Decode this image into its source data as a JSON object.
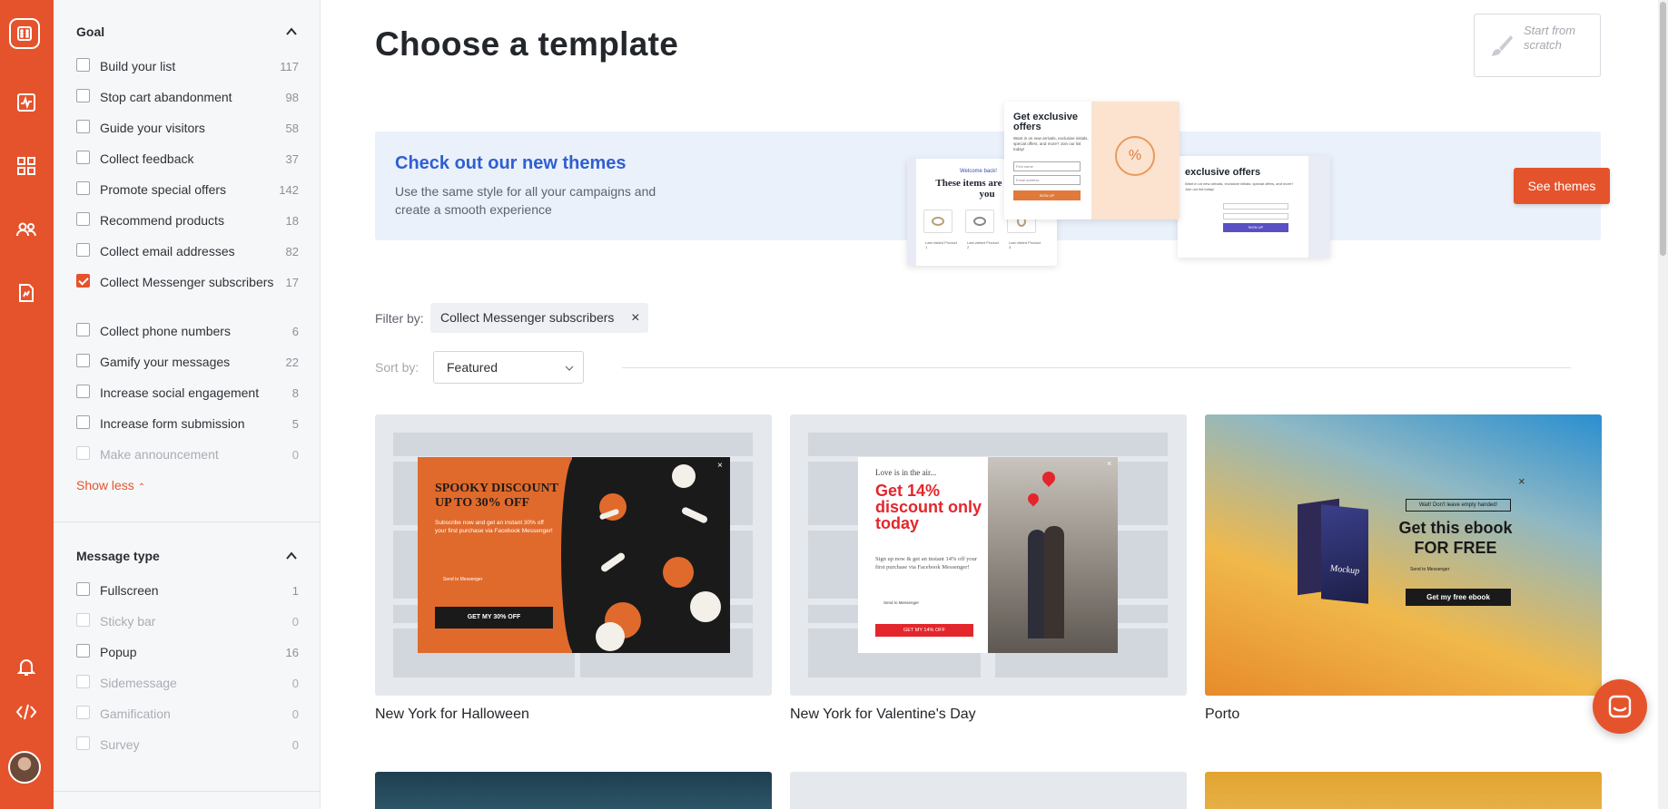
{
  "rail": {
    "icons": [
      "logo-icon",
      "analytics-icon",
      "campaigns-icon",
      "users-icon",
      "report-icon",
      "bell-icon",
      "code-icon",
      "avatar"
    ]
  },
  "sidebar": {
    "goal": {
      "heading": "Goal",
      "items": [
        {
          "label": "Build your list",
          "count": "117",
          "checked": false,
          "disabled": false
        },
        {
          "label": "Stop cart abandonment",
          "count": "98",
          "checked": false,
          "disabled": false
        },
        {
          "label": "Guide your visitors",
          "count": "58",
          "checked": false,
          "disabled": false
        },
        {
          "label": "Collect feedback",
          "count": "37",
          "checked": false,
          "disabled": false
        },
        {
          "label": "Promote special offers",
          "count": "142",
          "checked": false,
          "disabled": false
        },
        {
          "label": "Recommend products",
          "count": "18",
          "checked": false,
          "disabled": false
        },
        {
          "label": "Collect email addresses",
          "count": "82",
          "checked": false,
          "disabled": false
        },
        {
          "label": "Collect Messenger subscribers",
          "count": "17",
          "checked": true,
          "disabled": false
        },
        {
          "label": "Collect phone numbers",
          "count": "6",
          "checked": false,
          "disabled": false
        },
        {
          "label": "Gamify your messages",
          "count": "22",
          "checked": false,
          "disabled": false
        },
        {
          "label": "Increase social engagement",
          "count": "8",
          "checked": false,
          "disabled": false
        },
        {
          "label": "Increase form submission",
          "count": "5",
          "checked": false,
          "disabled": false
        },
        {
          "label": "Make announcement",
          "count": "0",
          "checked": false,
          "disabled": true
        }
      ],
      "show_less": "Show less"
    },
    "message_type": {
      "heading": "Message type",
      "items": [
        {
          "label": "Fullscreen",
          "count": "1",
          "disabled": false
        },
        {
          "label": "Sticky bar",
          "count": "0",
          "disabled": true
        },
        {
          "label": "Popup",
          "count": "16",
          "disabled": false
        },
        {
          "label": "Sidemessage",
          "count": "0",
          "disabled": true
        },
        {
          "label": "Gamification",
          "count": "0",
          "disabled": true
        },
        {
          "label": "Survey",
          "count": "0",
          "disabled": true
        }
      ]
    }
  },
  "main": {
    "title": "Choose a template",
    "start_scratch": "Start from scratch",
    "banner": {
      "heading": "Check out our new themes",
      "body": "Use the same style for all your campaigns and create a smooth experience",
      "button": "See themes",
      "mock_texts": {
        "left_kicker": "Welcome back!",
        "left_title": "These items are here for you",
        "left_products": [
          "Last visited Product 1",
          "Last visited Product 2",
          "Last visited Product 3"
        ],
        "center_title": "Get exclusive offers",
        "center_body": "Want in on new arrivals, exclusive initials, special offers, and more? Join our list today!",
        "center_inputs": [
          "First name",
          "Email address"
        ],
        "center_button": "SIGN UP",
        "right_title": "exclusive offers",
        "right_body": "Want in on new arrivals, exclusive initials, special offers, and more? Join our list today!",
        "right_button": "SIGN UP"
      }
    },
    "filter": {
      "label": "Filter by:",
      "chip": "Collect Messenger subscribers",
      "chip_close": "×"
    },
    "sort": {
      "label": "Sort by:",
      "value": "Featured"
    },
    "templates": [
      {
        "name": "New York for Halloween",
        "headline": "SPOOKY DISCOUNT UP TO 30% OFF",
        "body": "Subscribe now and get an instant 30% off your first purchase via Facebook Messenger!",
        "send_to": "Send to Messenger",
        "cta": "GET MY 30% OFF"
      },
      {
        "name": "New York for Valentine's Day",
        "kicker": "Love is in the air...",
        "headline": "Get 14% discount only today",
        "body": "Sign up now & get an instant 14% off your first purchase via Facebook Messenger!",
        "send_to": "Send to Messenger",
        "cta": "GET MY 14% OFF"
      },
      {
        "name": "Porto",
        "kicker": "Wait! Don't leave empty handed!",
        "headline": "Get this ebook FOR FREE",
        "send_to": "Send to Messenger",
        "cta": "Get my free ebook",
        "book": "Mockup"
      }
    ]
  }
}
